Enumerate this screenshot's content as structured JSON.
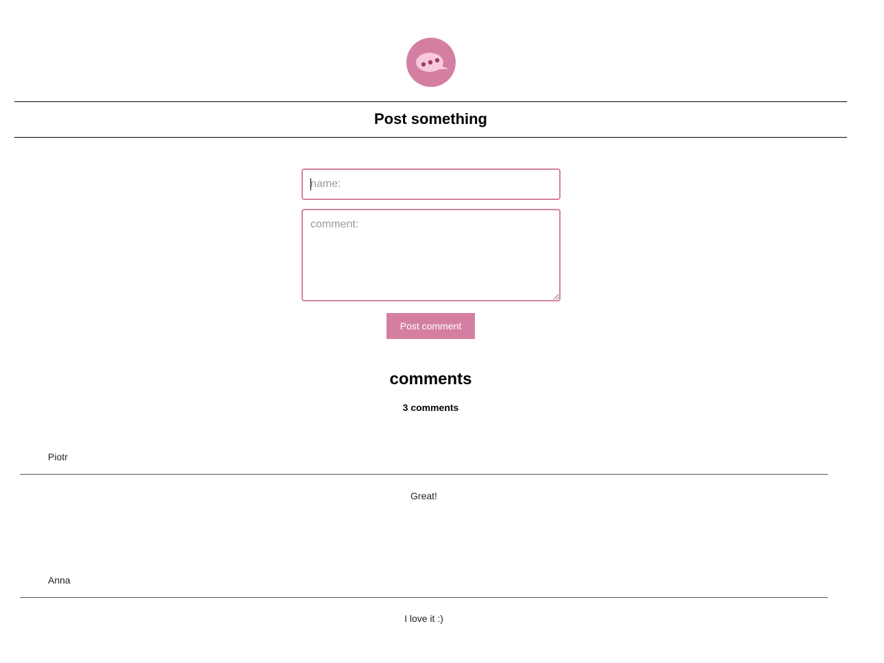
{
  "header": {
    "logo_icon": "chat-bubble-icon",
    "title": "Post something"
  },
  "form": {
    "name_placeholder": "name:",
    "name_value": "",
    "comment_placeholder": "comment:",
    "comment_value": "",
    "submit_label": "Post comment"
  },
  "comments_section": {
    "heading": "comments",
    "count_label": "3 comments",
    "items": [
      {
        "author": "Piotr",
        "text": "Great!"
      },
      {
        "author": "Anna",
        "text": "I love it :)"
      }
    ]
  },
  "colors": {
    "accent": "#d47fa1",
    "accent_light": "#f7c9db",
    "accent_dark": "#9c3f64"
  }
}
